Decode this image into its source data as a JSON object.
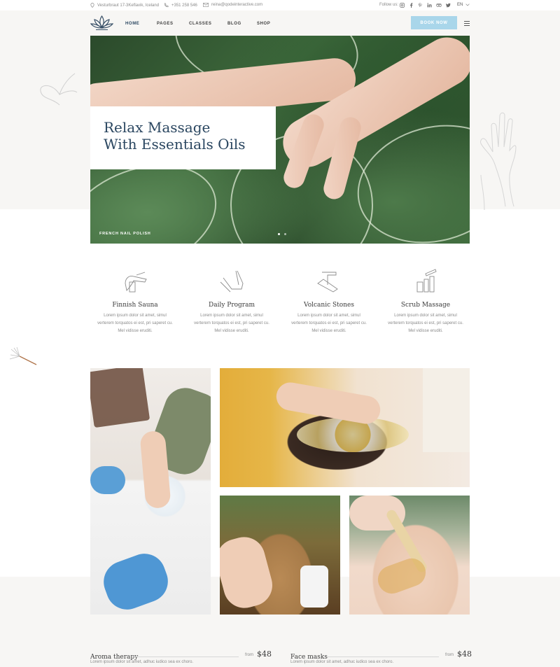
{
  "topbar": {
    "address": "Vesturbraut 17-3Keflavik, Iceland",
    "phone": "+351 258 546",
    "email": "reina@qodeinteractive.com",
    "follow_label": "Follow us:",
    "social_icons": [
      "instagram-icon",
      "facebook-icon",
      "pinterest-icon",
      "linkedin-icon",
      "tripadvisor-icon",
      "twitter-icon"
    ],
    "language": "EN"
  },
  "nav": {
    "items": [
      "HOME",
      "PAGES",
      "CLASSES",
      "BLOG",
      "SHOP"
    ],
    "active": "HOME",
    "book_label": "BOOK NOW"
  },
  "hero": {
    "title_line1": "Relax Massage",
    "title_line2": "With Essentials Oils",
    "caption": "FRENCH NAIL POLISH",
    "slides": 2,
    "active_slide": 1
  },
  "services": [
    {
      "title": "Finnish Sauna",
      "icon": "nail-file-icon",
      "desc": [
        "Lorem ipsum dolor sit amet, simul",
        "verterem torquatos ei est, pri saperet cu.",
        "Mel vidisse eruditi."
      ]
    },
    {
      "title": "Daily Program",
      "icon": "pedicure-icon",
      "desc": [
        "Lorem ipsum dolor sit amet, simul",
        "verterem torquatos ei est, pri saperet cu.",
        "Mel vidisse eruditi."
      ]
    },
    {
      "title": "Volcanic Stones",
      "icon": "brush-icon",
      "desc": [
        "Lorem ipsum dolor sit amet, simul",
        "verterem torquatos ei est, pri saperet cu.",
        "Mel vidisse eruditi."
      ]
    },
    {
      "title": "Scrub Massage",
      "icon": "cosmetics-icon",
      "desc": [
        "Lorem ipsum dolor sit amet, simul",
        "verterem torquatos ei est, pri saperet cu.",
        "Mel vidisse eruditi."
      ]
    }
  ],
  "prices": [
    {
      "name": "Aroma therapy",
      "from": "from",
      "price": "$48",
      "desc": "Lorem ipsum dolor sit amet, adhuc iudico sea ex choro."
    },
    {
      "name": "Face masks",
      "from": "from",
      "price": "$48",
      "desc": "Lorem ipsum dolor sit amet, adhuc iudico sea ex choro."
    }
  ],
  "colors": {
    "accent": "#a9d6ea",
    "heading": "#2a4660",
    "band": "#f7f6f4"
  }
}
